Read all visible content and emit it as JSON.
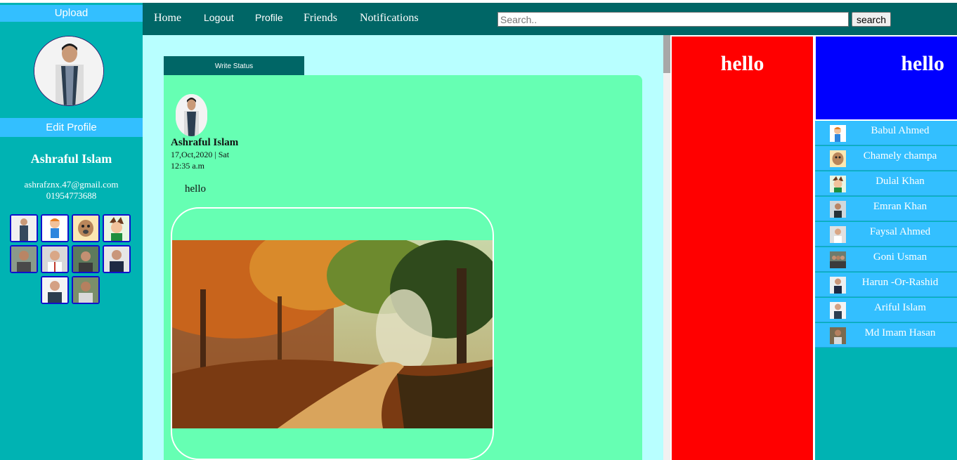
{
  "sidebar": {
    "upload_label": "Upload",
    "edit_profile_label": "Edit Profile",
    "user_name": "Ashraful Islam",
    "email": "ashrafznx.47@gmail.com",
    "phone": "01954773688"
  },
  "nav": {
    "home": "Home",
    "logout": "Logout",
    "profile": "Profile",
    "friends": "Friends",
    "notifications": "Notifications",
    "search_placeholder": "Search..",
    "search_button": "search"
  },
  "feed": {
    "write_status_label": "Write Status",
    "post": {
      "author": "Ashraful Islam",
      "date": "17,Oct,2020 | Sat",
      "time": "12:35 a.m",
      "text": "hello"
    }
  },
  "panels": {
    "red_title": "hello",
    "blue_title": "hello"
  },
  "friends": [
    {
      "name": "Babul Ahmed"
    },
    {
      "name": "Chamely champa"
    },
    {
      "name": "Dulal Khan"
    },
    {
      "name": "Emran Khan"
    },
    {
      "name": "Faysal Ahmed"
    },
    {
      "name": "Goni Usman"
    },
    {
      "name": "Harun -Or-Rashid"
    },
    {
      "name": "Ariful Islam"
    },
    {
      "name": "Md Imam Hasan"
    }
  ],
  "colors": {
    "sidebar": "#00b3b3",
    "accent_bar": "#33bfff",
    "nav": "#006666",
    "feed_bg": "#b8ffff",
    "post_bg": "#66ffb3",
    "red_panel": "#ff0000",
    "blue_panel": "#0000ff"
  }
}
